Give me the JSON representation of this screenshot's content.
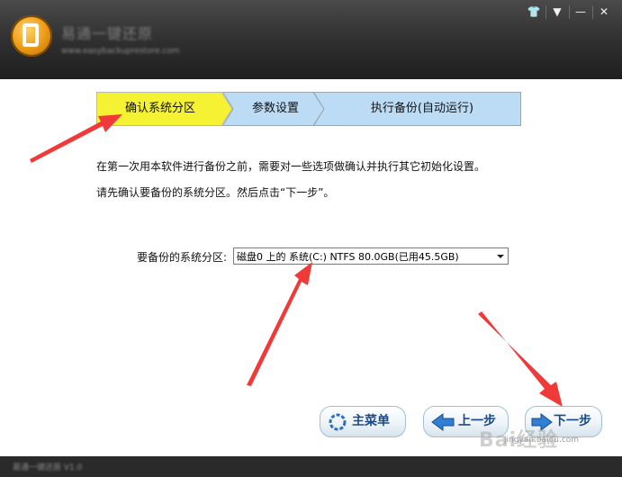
{
  "window": {
    "app_title": "易通一键还原",
    "app_url": "www.easybackuprestore.com",
    "controls": {
      "skin_label": "👕",
      "menu_label": "▼",
      "minimize_label": "—",
      "close_label": "✕"
    }
  },
  "steps": [
    {
      "label": "确认系统分区",
      "state": "active",
      "color": "#f4f232"
    },
    {
      "label": "参数设置",
      "state": "pending",
      "color": "#bcdcf6"
    },
    {
      "label": "执行备份(自动运行)",
      "state": "pending",
      "color": "#bcdcf6"
    }
  ],
  "intro": {
    "line1": "在第一次用本软件进行备份之前，需要对一些选项做确认并执行其它初始化设置。",
    "line2": "请先确认要备份的系统分区。然后点击“下一步”。"
  },
  "partition": {
    "label": "要备份的系统分区:",
    "selected": "磁盘0 上的 系统(C:) NTFS 80.0GB(已用45.5GB)"
  },
  "buttons": {
    "main_menu": "主菜单",
    "prev": "上一步",
    "next": "下一步"
  },
  "statusbar": {
    "text": "易通一键还原 V1.0"
  },
  "watermark": {
    "logo": "Bai经验",
    "url": "jingyan.baidu.com"
  },
  "colors": {
    "annotation_arrow": "#f03a3a",
    "button_text": "#1a4a8a"
  }
}
